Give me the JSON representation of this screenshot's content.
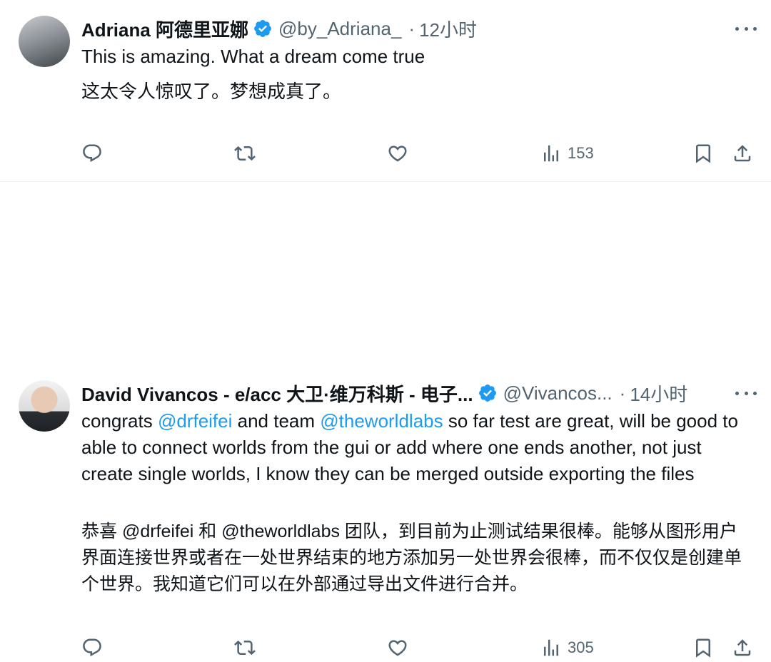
{
  "colors": {
    "accent": "#1d9bf0",
    "secondary_text": "#536471",
    "primary_text": "#0f1419",
    "divider": "#eff3f4"
  },
  "tweets": [
    {
      "author_name": "Adriana 阿德里亚娜",
      "handle": "@by_Adriana_",
      "separator": "·",
      "time": "12小时",
      "verified": true,
      "text_parts": [
        "This is amazing. What a dream come true"
      ],
      "translation": "这太令人惊叹了。梦想成真了。",
      "views": "153",
      "icons": [
        "reply-icon",
        "retweet-icon",
        "like-icon",
        "views-icon",
        "bookmark-icon",
        "share-icon"
      ]
    },
    {
      "author_name": "David Vivancos - e/acc 大卫·维万科斯 - 电子...",
      "handle": "@Vivancos...",
      "separator": "·",
      "time": "14小时",
      "verified": true,
      "text_parts": [
        "congrats ",
        "@drfeifei",
        " and team ",
        "@theworldlabs",
        " so far test are great, will be good to able to connect worlds from the gui or add where one ends another, not just create single worlds, I know they can be merged outside exporting the files"
      ],
      "translation": "恭喜 @drfeifei 和 @theworldlabs 团队，到目前为止测试结果很棒。能够从图形用户界面连接世界或者在一处世界结束的地方添加另一处世界会很棒，而不仅仅是创建单个世界。我知道它们可以在外部通过导出文件进行合并。",
      "views": "305",
      "icons": [
        "reply-icon",
        "retweet-icon",
        "like-icon",
        "views-icon",
        "bookmark-icon",
        "share-icon"
      ]
    }
  ]
}
